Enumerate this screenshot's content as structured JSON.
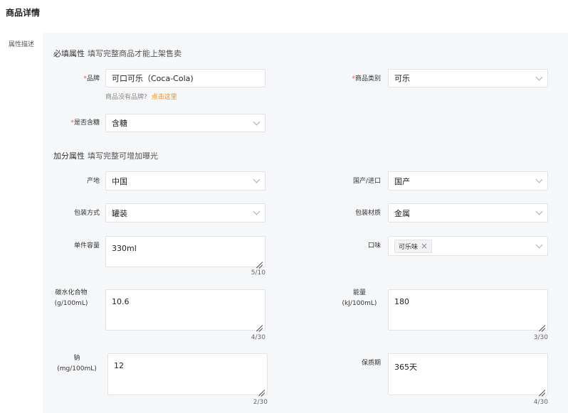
{
  "page_title": "商品详情",
  "side_label": "属性描述",
  "required_section": {
    "title": "必填属性",
    "hint": "填写完整商品才能上架售卖"
  },
  "bonus_section": {
    "title": "加分属性",
    "hint": "填写完整可增加曝光"
  },
  "required_mark": "*",
  "fields": {
    "brand": {
      "label": "品牌",
      "value": "可口可乐（Coca-Cola)",
      "note": "商品没有品牌?",
      "link": "点击这里"
    },
    "category": {
      "label": "商品类别",
      "value": "可乐"
    },
    "sugar": {
      "label": "是否含糖",
      "value": "含糖"
    },
    "origin": {
      "label": "产地",
      "value": "中国"
    },
    "import": {
      "label": "国产/进口",
      "value": "国产"
    },
    "package": {
      "label": "包装方式",
      "value": "罐装"
    },
    "material": {
      "label": "包装材质",
      "value": "金属"
    },
    "volume": {
      "label": "单件容量",
      "value": "330ml",
      "count": "5/10"
    },
    "flavor": {
      "label": "口味",
      "tag": "可乐味"
    },
    "carbs": {
      "label": "碳水化合物",
      "unit": "(g/100mL)",
      "value": "10.6",
      "count": "4/30"
    },
    "energy": {
      "label": "能量",
      "unit": "(kJ/100mL)",
      "value": "180",
      "count": "3/30"
    },
    "sodium": {
      "label": "钠",
      "unit": "(mg/100mL)",
      "value": "12",
      "count": "2/30"
    },
    "shelf_life": {
      "label": "保质期",
      "value": "365天",
      "count": "4/30"
    }
  }
}
